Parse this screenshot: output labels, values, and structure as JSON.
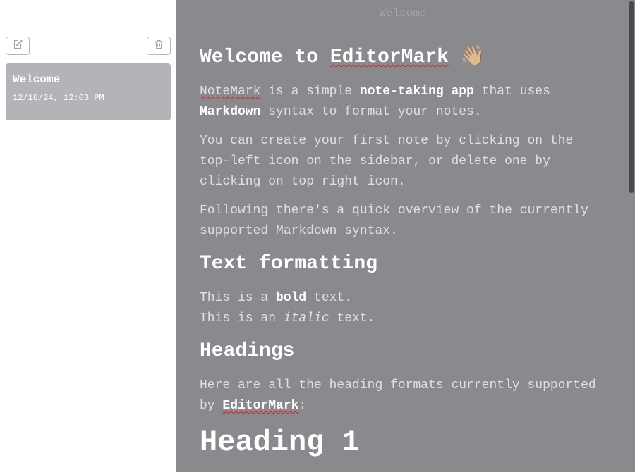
{
  "sidebar": {
    "new_note_icon": "edit-icon",
    "delete_note_icon": "trash-icon",
    "notes": [
      {
        "title": "Welcome",
        "date": "12/18/24, 12:03 PM"
      }
    ]
  },
  "editor": {
    "document_title": "Welcome",
    "h1": {
      "prefix": "Welcome to ",
      "brand": "EditorMark",
      "emoji": "👋🏼"
    },
    "p1": {
      "brand": "NoteMark",
      "t1": " is a simple ",
      "bold1": "note-taking app",
      "t2": " that uses ",
      "bold2": "Markdown",
      "t3": " syntax to format your notes."
    },
    "p2": "You can create your first note by clicking on the top-left icon on the sidebar, or delete one by clicking on top right icon.",
    "p3": "Following there's a quick overview of the currently supported Markdown syntax.",
    "section_text_formatting": "Text formatting",
    "bold_line": {
      "pre": "This is a ",
      "bold": "bold",
      "post": " text."
    },
    "italic_line": {
      "pre": "This is an ",
      "italic": "italic",
      "post": " text."
    },
    "section_headings": "Headings",
    "headings_intro": {
      "t1": "Here are all the heading formats currently supported ",
      "t2": "by ",
      "brand": "EditorMark",
      "t3": ":"
    },
    "heading1_sample": "Heading 1"
  },
  "colors": {
    "editor_bg": "#8a898d",
    "sidebar_bg": "#ffffff",
    "note_card_bg": "#b4b3b8",
    "scroll_thumb": "#4a4a4e"
  }
}
